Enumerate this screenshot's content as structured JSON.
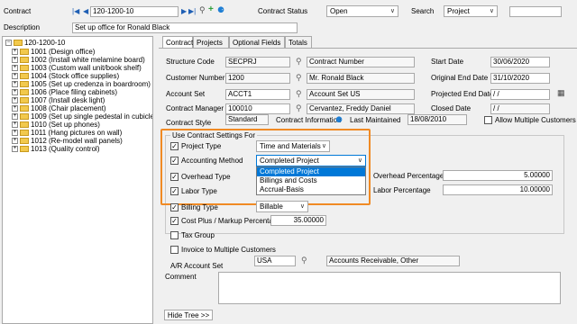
{
  "header": {
    "contract_label": "Contract",
    "contract_value": "120-1200-10",
    "description_label": "Description",
    "description_value": "Set up office for Ronald Black",
    "status_label": "Contract Status",
    "status_value": "Open",
    "search_label": "Search",
    "search_value": "Project"
  },
  "tree": {
    "root": "120-1200-10",
    "items": [
      "1001 (Design office)",
      "1002 (Install white melamine board)",
      "1003 (Custom wall unit/book shelf)",
      "1004 (Stock office supplies)",
      "1005 (Set up credenza in boardroom)",
      "1006 (Place filing cabinets)",
      "1007 (Install desk light)",
      "1008 (Chair placement)",
      "1009 (Set up single pedestal in cubicles)",
      "1010 (Set up phones)",
      "1011 (Hang pictures on wall)",
      "1012 (Re-model wall panels)",
      "1013 (Quality control)"
    ]
  },
  "tabs": [
    "Contract",
    "Projects",
    "Optional Fields",
    "Totals"
  ],
  "form": {
    "structure_code_label": "Structure Code",
    "structure_code": "SECPRJ",
    "contract_number": "Contract Number",
    "customer_number_label": "Customer Number",
    "customer_number": "1200",
    "customer_name": "Mr. Ronald Black",
    "account_set_label": "Account Set",
    "account_set": "ACCT1",
    "account_set_desc": "Account Set US",
    "contract_manager_label": "Contract Manager",
    "contract_manager": "100010",
    "contract_manager_name": "Cervantez, Freddy Daniel",
    "contract_style_label": "Contract Style",
    "contract_style": "Standard",
    "contract_information": "Contract Information",
    "last_maintained_label": "Last Maintained",
    "last_maintained": "18/08/2010",
    "allow_multiple_customers": "Allow Multiple Customers",
    "start_date_label": "Start Date",
    "start_date": "30/06/2020",
    "original_end_date_label": "Original End Date",
    "original_end_date": "31/10/2020",
    "projected_end_date_label": "Projected End Date",
    "projected_end_date": "/ /",
    "closed_date_label": "Closed Date",
    "closed_date": "/ /",
    "settings_group_title": "Use Contract Settings For",
    "project_type_label": "Project Type",
    "project_type": "Time and Materials",
    "accounting_method_label": "Accounting Method",
    "accounting_method": "Completed Project",
    "accounting_options": [
      "Completed Project",
      "Billings and Costs",
      "Accrual-Basis"
    ],
    "overhead_type_label": "Overhead Type",
    "labor_type_label": "Labor Type",
    "overhead_percentage_label": "Overhead Percentage",
    "overhead_percentage": "5.00000",
    "labor_percentage_label": "Labor Percentage",
    "labor_percentage": "10.00000",
    "billing_type_label": "Billing Type",
    "billing_type": "Billable",
    "cost_plus_label": "Cost Plus / Markup Percentage",
    "cost_plus": "35.00000",
    "tax_group_label": "Tax Group",
    "invoice_multiple_label": "Invoice to Multiple Customers",
    "ar_account_set_label": "A/R Account Set",
    "ar_account_set": "USA",
    "ar_account_set_desc": "Accounts Receivable, Other",
    "comment_label": "Comment",
    "hide_tree": "Hide Tree >>"
  },
  "colors": {
    "highlight": "#f08a24",
    "selection": "#0078d7"
  }
}
